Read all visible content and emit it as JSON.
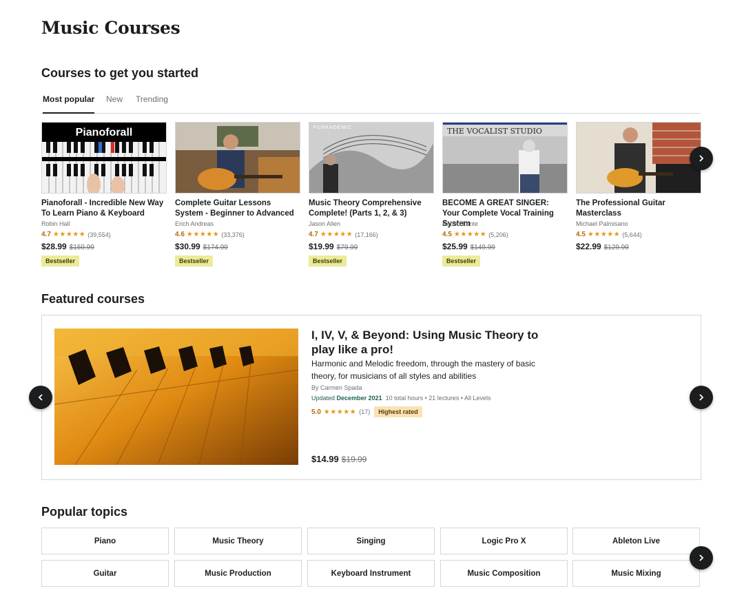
{
  "page": {
    "title": "Music Courses"
  },
  "started": {
    "heading": "Courses to get you started",
    "tabs": [
      {
        "label": "Most popular"
      },
      {
        "label": "New"
      },
      {
        "label": "Trending"
      }
    ],
    "courses": [
      {
        "title": "Pianoforall - Incredible New Way To Learn Piano & Keyboard",
        "instructor": "Robin Hall",
        "rating": "4.7",
        "stars": "★★★★★",
        "count": "(39,554)",
        "price": "$28.99",
        "old_price": "$159.99",
        "badge": "Bestseller",
        "thumb_text": "Pianoforall"
      },
      {
        "title": "Complete Guitar Lessons System - Beginner to Advanced",
        "instructor": "Erich Andreas",
        "rating": "4.6",
        "stars": "★★★★★",
        "count": "(33,376)",
        "price": "$30.99",
        "old_price": "$174.99",
        "badge": "Bestseller"
      },
      {
        "title": "Music Theory Comprehensive Complete! (Parts 1, 2, & 3)",
        "instructor": "Jason Allen",
        "rating": "4.7",
        "stars": "★★★★★",
        "count": "(17,166)",
        "price": "$19.99",
        "old_price": "$79.99",
        "badge": "Bestseller",
        "thumb_text": "FUNKADEMIC"
      },
      {
        "title": "BECOME A GREAT SINGER: Your Complete Vocal Training System",
        "instructor": "Robert Lunte",
        "rating": "4.5",
        "stars": "★★★★★",
        "count": "(5,206)",
        "price": "$25.99",
        "old_price": "$149.99",
        "badge": "Bestseller",
        "thumb_text": "THE VOCALIST STUDIO"
      },
      {
        "title": "The Professional Guitar Masterclass",
        "instructor": "Michael Palmisano",
        "rating": "4.5",
        "stars": "★★★★★",
        "count": "(5,644)",
        "price": "$22.99",
        "old_price": "$129.99",
        "badge": ""
      }
    ]
  },
  "featured": {
    "heading": "Featured courses",
    "title": "I, IV, V, & Beyond: Using Music Theory to play like a pro!",
    "description": "Harmonic and Melodic freedom, through the mastery of basic theory, for musicians of all styles and abilities",
    "author": "By Carmen Spada",
    "updated_label": "Updated",
    "updated_date": "December 2021",
    "meta": "10 total hours • 21 lectures • All Levels",
    "rating": "5.0",
    "stars": "★★★★★",
    "count": "(17)",
    "badge": "Highest rated",
    "price": "$14.99",
    "old_price": "$19.99"
  },
  "topics": {
    "heading": "Popular topics",
    "items": [
      {
        "label": "Piano"
      },
      {
        "label": "Music Theory"
      },
      {
        "label": "Singing"
      },
      {
        "label": "Logic Pro X"
      },
      {
        "label": "Ableton Live"
      },
      {
        "label": "Guitar"
      },
      {
        "label": "Music Production"
      },
      {
        "label": "Keyboard Instrument"
      },
      {
        "label": "Music Composition"
      },
      {
        "label": "Music Mixing"
      }
    ]
  },
  "colors": {
    "rating": "#b4690e",
    "stars": "#e59819",
    "bestseller": "#eceb98",
    "highest_rated": "#fbe1b6",
    "updated": "#1e6055"
  }
}
